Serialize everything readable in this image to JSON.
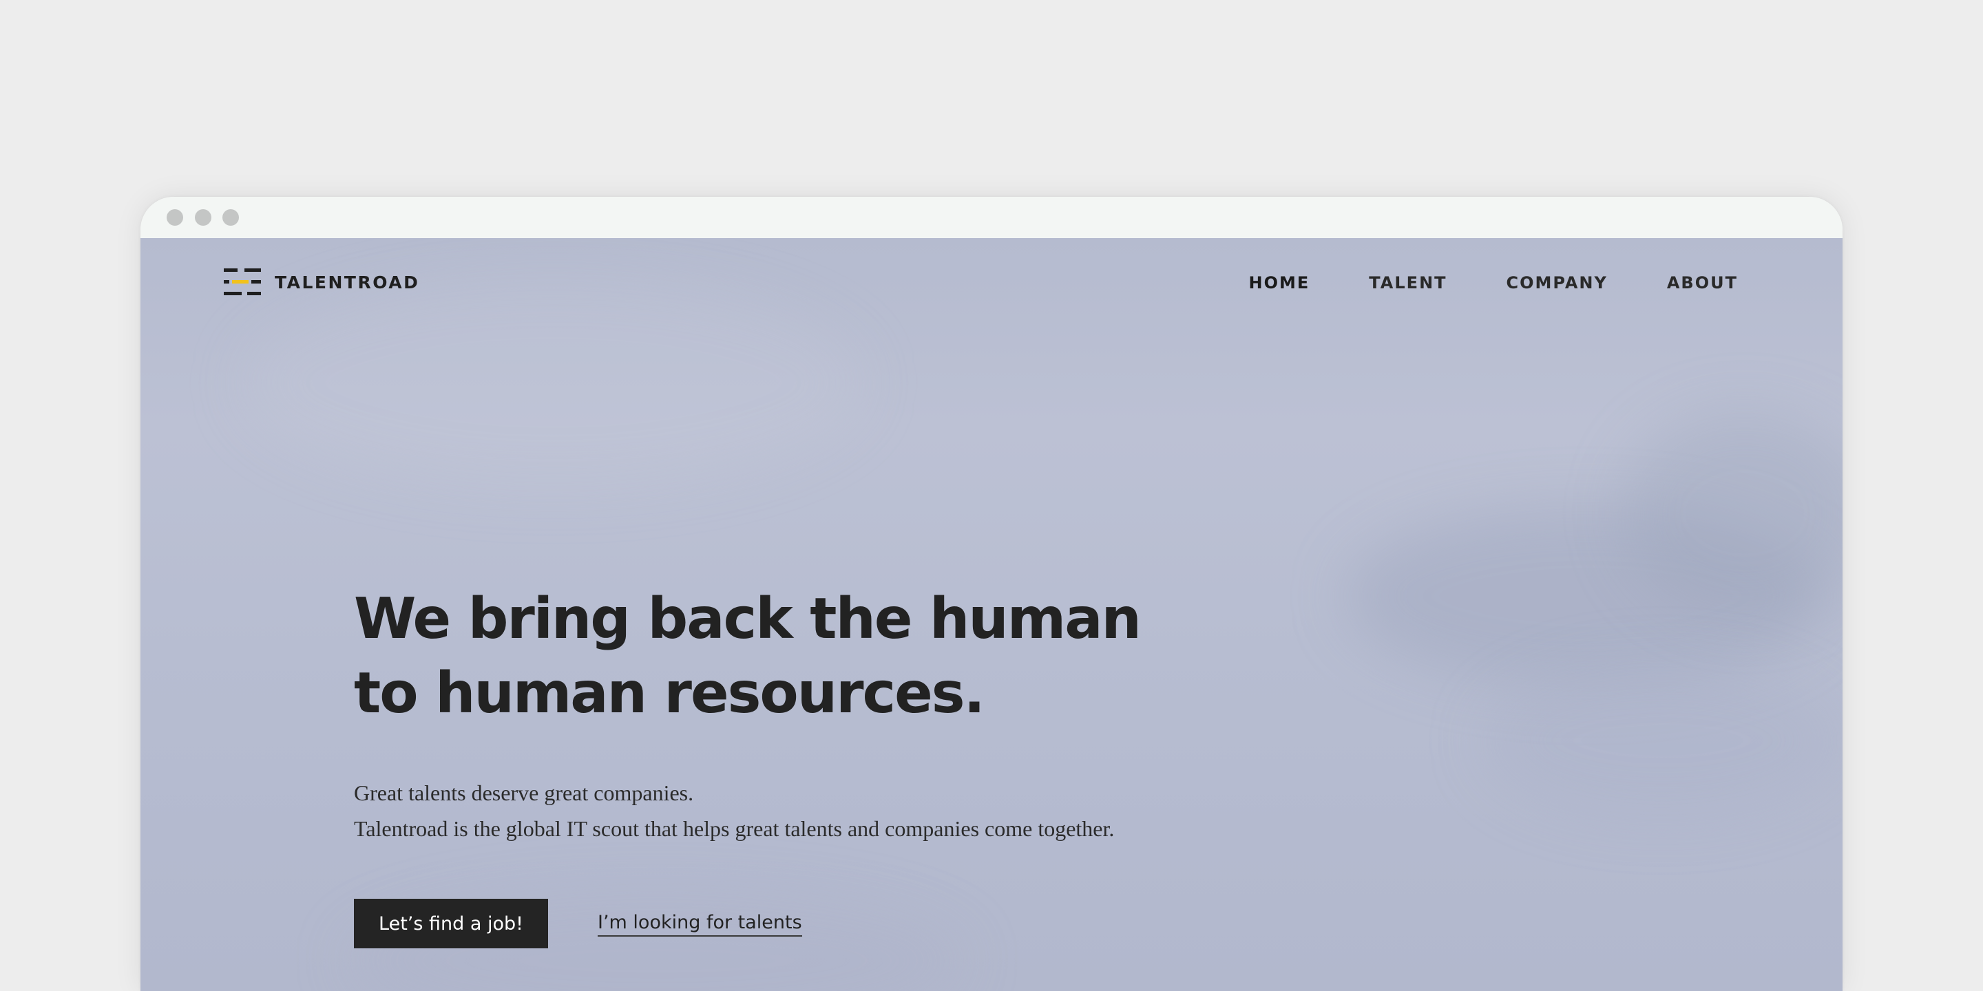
{
  "brand": {
    "name": "TALENTROAD",
    "accent_color": "#f2c21b",
    "logo_icon": "road-lines-icon"
  },
  "nav": {
    "items": [
      {
        "label": "HOME",
        "active": true
      },
      {
        "label": "TALENT",
        "active": false
      },
      {
        "label": "COMPANY",
        "active": false
      },
      {
        "label": "ABOUT",
        "active": false
      }
    ]
  },
  "hero": {
    "title_line1": "We bring back the human",
    "title_line2": "to human resources.",
    "subtitle_line1": "Great talents deserve great companies.",
    "subtitle_line2": "Talentroad is the global IT scout that helps great talents and companies come together.",
    "primary_cta": "Let’s find a job!",
    "secondary_cta": "I’m looking for talents"
  }
}
